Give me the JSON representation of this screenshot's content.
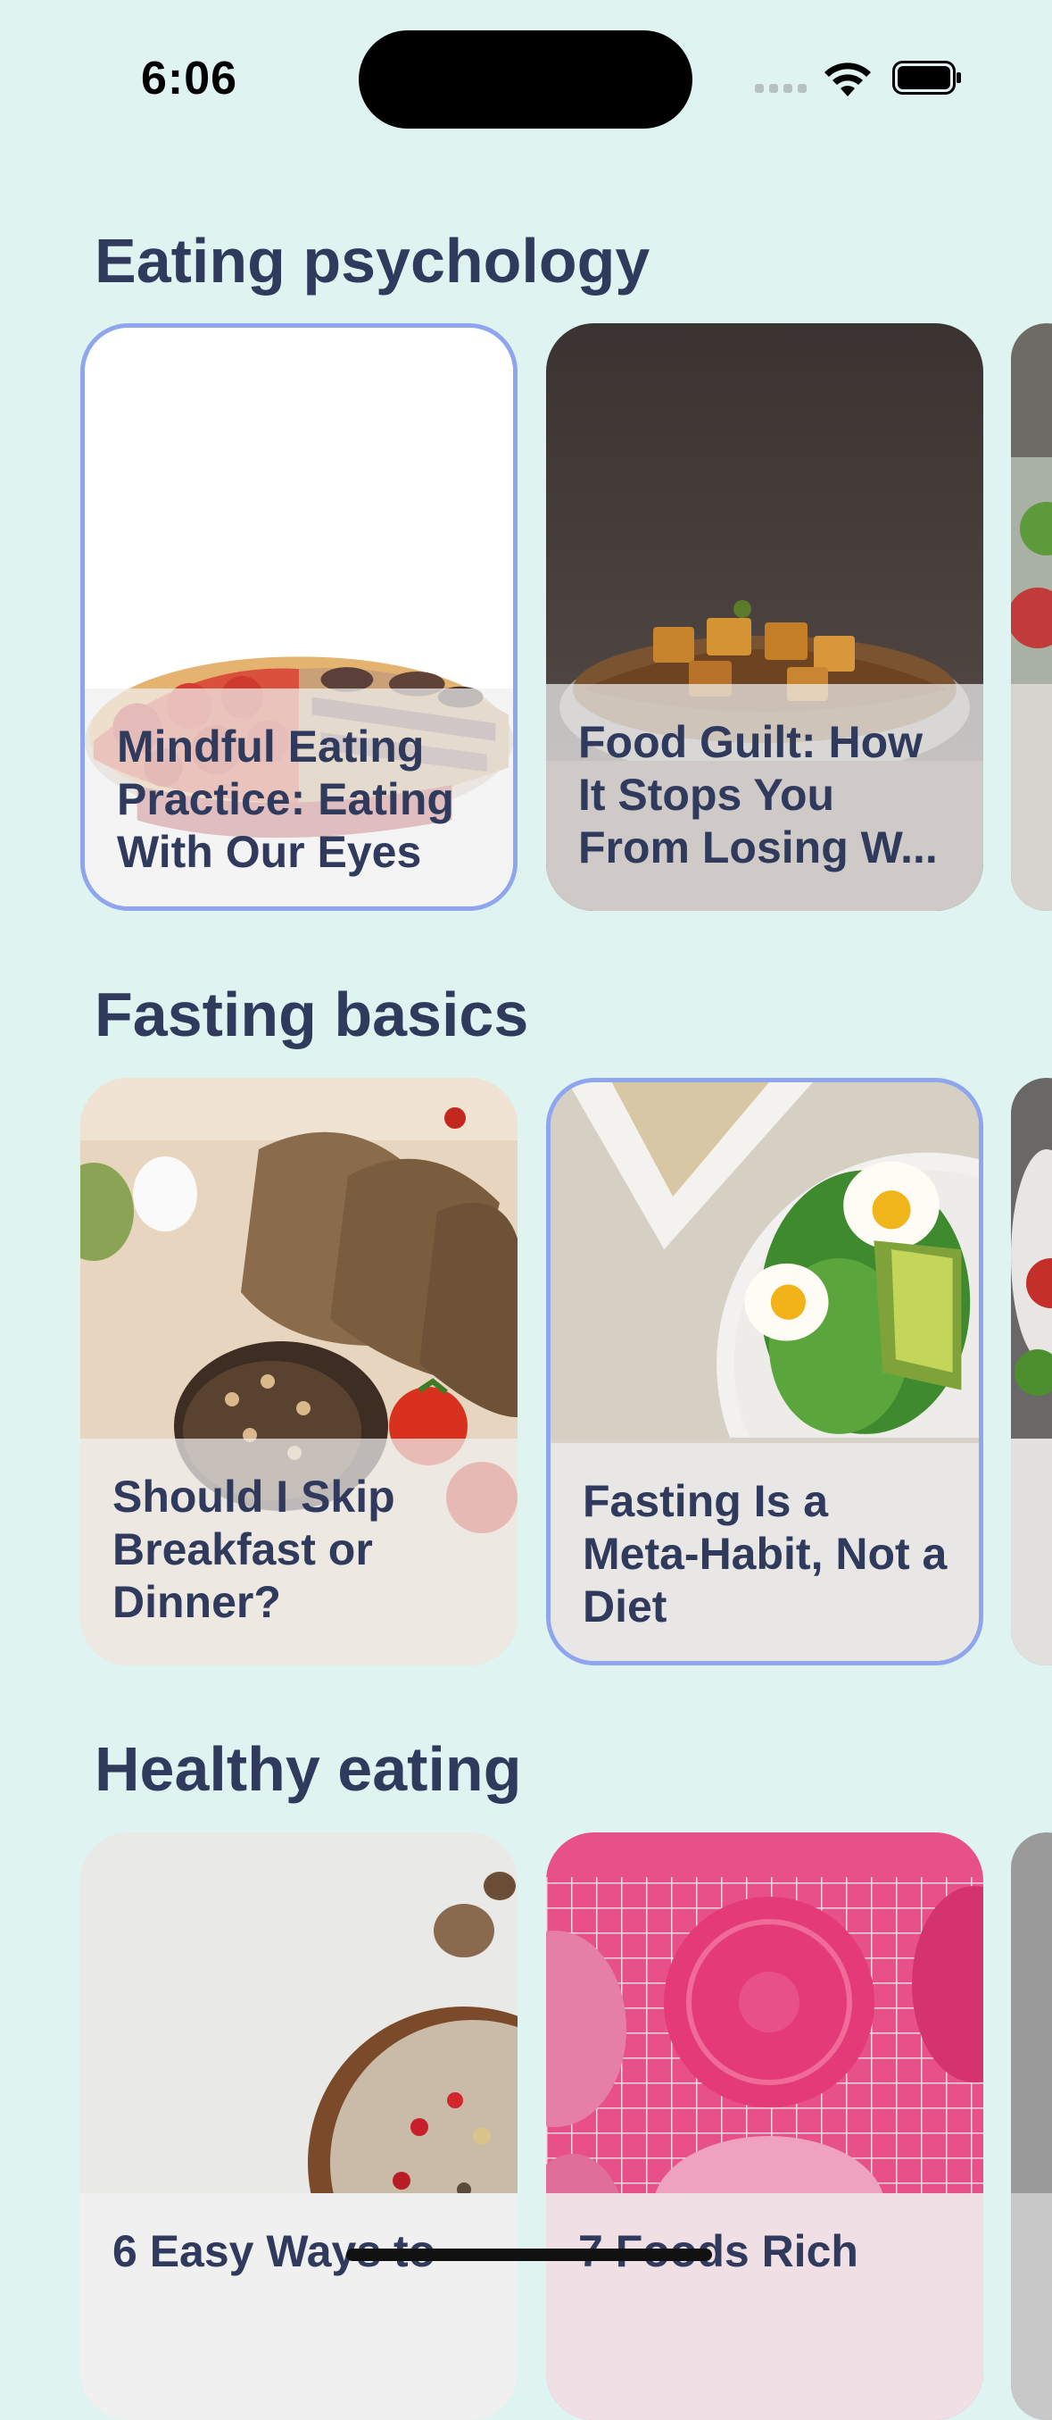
{
  "status_bar": {
    "time": "6:06"
  },
  "sections": [
    {
      "title": "Eating psychology",
      "cards": [
        {
          "title": "Mindful Eating Practice: Eating With Our Eyes",
          "image": "pizza-photo"
        },
        {
          "title": "Food Guilt: How It Stops You From Losing W...",
          "image": "noodles-tofu-photo"
        }
      ]
    },
    {
      "title": "Fasting basics",
      "cards": [
        {
          "title": "Should I Skip Breakfast or Dinner?",
          "image": "bread-photo"
        },
        {
          "title": "Fasting Is a Meta-Habit, Not a Diet",
          "image": "salad-photo"
        }
      ]
    },
    {
      "title": "Healthy eating",
      "cards": [
        {
          "title": "6 Easy Ways to",
          "image": "granola-bowl-photo"
        },
        {
          "title": "7 Foods Rich",
          "image": "donuts-photo"
        }
      ]
    }
  ],
  "colors": {
    "background": "#dff3f1",
    "title": "#2f3a5c",
    "selected_border": "#8fa5ee"
  }
}
